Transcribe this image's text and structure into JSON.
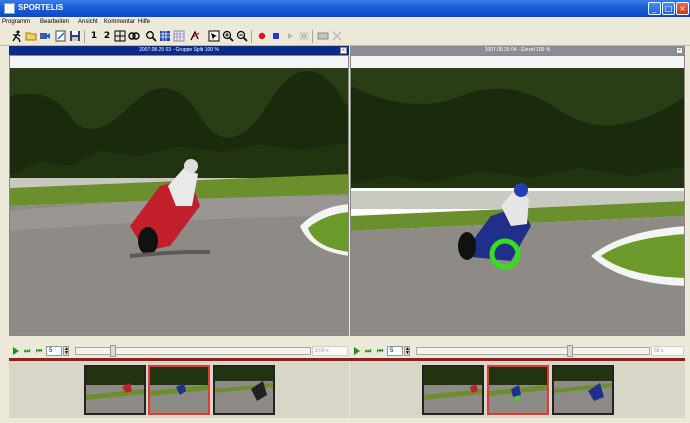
{
  "window": {
    "title": "SPORTELIS"
  },
  "menu": [
    "Programm",
    "Bearbeiten",
    "Ansicht",
    "Kommentar",
    "Hilfe"
  ],
  "toolbar": {
    "one_label": "1",
    "two_label": "2"
  },
  "left_panel": {
    "caption": "2007.08.25 03 - Gruppe Split 100 %",
    "frame_step": "5",
    "time": "2,04 s"
  },
  "right_panel": {
    "caption": "2007.08.25 04 - Einzel 100 %",
    "frame_step": "5",
    "time": "58 s"
  },
  "colors": {
    "titlebar": "#0a48c8",
    "caption_left": "#0b2a8e",
    "caption_right": "#8c8c96",
    "selected_thumbnail": "#e23838",
    "highlight_ring": "#33e01b",
    "play_green": "#1a8f1a"
  },
  "icons": [
    "runner-icon",
    "folder-icon",
    "record-video-icon",
    "edit-icon",
    "save-icon",
    "grid-icon",
    "search-icon",
    "layout-icon",
    "draw-icon",
    "zoom-in-icon",
    "zoom-out-icon",
    "record-icon",
    "stop-icon",
    "play-icon",
    "marker-icon",
    "tools-icon"
  ]
}
